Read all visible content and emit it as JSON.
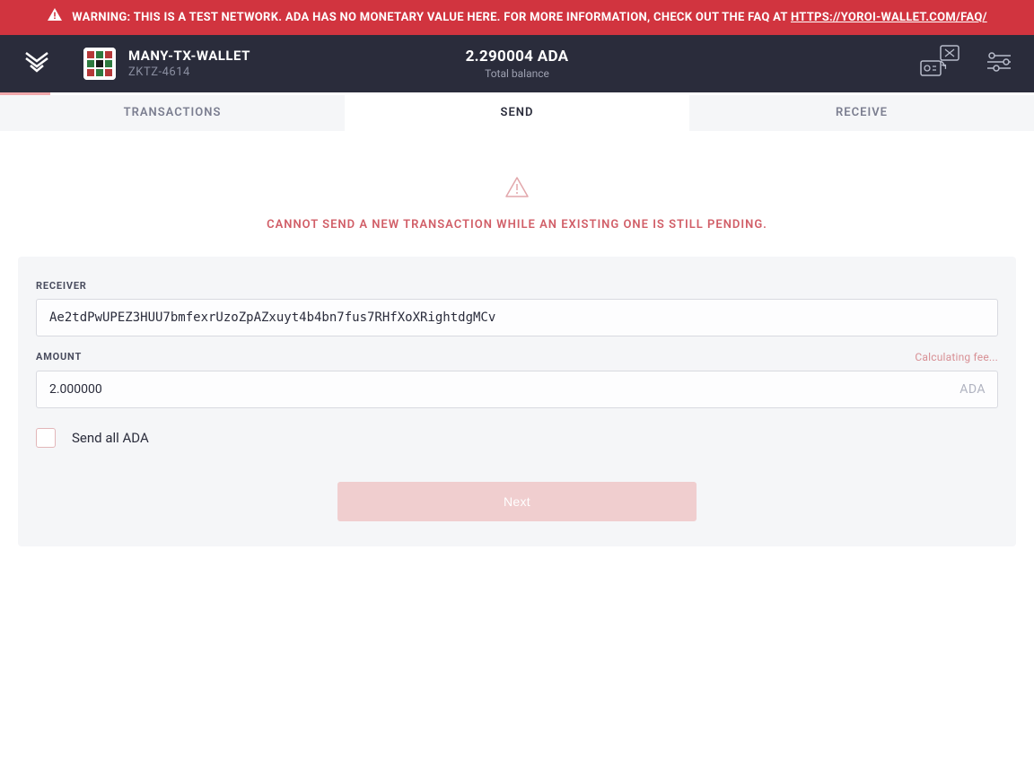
{
  "banner": {
    "prefix": "WARNING: THIS IS A TEST NETWORK. ADA HAS NO MONETARY VALUE HERE. FOR MORE INFORMATION, CHECK OUT THE FAQ AT ",
    "link_text": "HTTPS://YOROI-WALLET.COM/FAQ/"
  },
  "header": {
    "wallet_name": "MANY-TX-WALLET",
    "wallet_hash": "ZKTZ-4614",
    "balance_amount": "2.290004 ADA",
    "balance_label": "Total balance"
  },
  "tabs": {
    "transactions": "TRANSACTIONS",
    "send": "SEND",
    "receive": "RECEIVE",
    "active": "send"
  },
  "pending": {
    "message": "CANNOT SEND A NEW TRANSACTION WHILE AN EXISTING ONE IS STILL PENDING."
  },
  "form": {
    "receiver_label": "RECEIVER",
    "receiver_value": "Ae2tdPwUPEZ3HUU7bmfexrUzoZpAZxuyt4b4bn7fus7RHfXoXRightdgMCv",
    "amount_label": "AMOUNT",
    "amount_value": "2.000000",
    "amount_suffix": "ADA",
    "fee_status": "Calculating fee...",
    "send_all_label": "Send all ADA",
    "send_all_checked": false,
    "submit_label": "Next"
  },
  "colors": {
    "danger": "#D1343F",
    "danger_light": "#F0CECF",
    "header_bg": "#2a2c3b",
    "muted": "#8a8ea0"
  }
}
